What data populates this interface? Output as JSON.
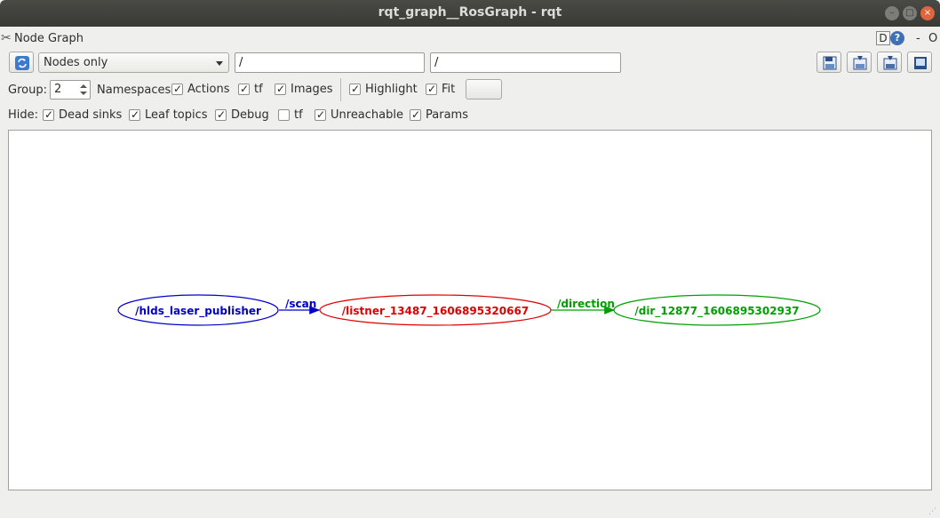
{
  "window": {
    "title": "rqt_graph__RosGraph - rqt"
  },
  "plugin": {
    "title": "Node Graph",
    "d_label": "D",
    "help_label": "?",
    "min_label": "-",
    "o_label": "O"
  },
  "toolbar": {
    "graph_type": "Nodes only",
    "filter_include": "/",
    "filter_exclude": "/"
  },
  "options": {
    "group_label": "Group:",
    "group_value": "2",
    "namespaces_label": "Namespaces",
    "actions_label": "Actions",
    "tf_label": "tf",
    "images_label": "Images",
    "highlight_label": "Highlight",
    "fit_label": "Fit"
  },
  "hide": {
    "label": "Hide:",
    "dead_sinks_label": "Dead sinks",
    "leaf_topics_label": "Leaf topics",
    "debug_label": "Debug",
    "tf_label": "tf",
    "unreachable_label": "Unreachable",
    "params_label": "Params"
  },
  "checkbox_states": {
    "actions": true,
    "tf": true,
    "images": true,
    "highlight": true,
    "fit": true,
    "dead_sinks": true,
    "leaf_topics": true,
    "debug": true,
    "hide_tf": false,
    "unreachable": true,
    "params": true
  },
  "graph": {
    "nodes": [
      {
        "label": "/hlds_laser_publisher",
        "color": "#0000cc"
      },
      {
        "label": "/listner_13487_1606895320667",
        "color": "#e00000"
      },
      {
        "label": "/dir_12877_1606895302937",
        "color": "#00a000"
      }
    ],
    "edges": [
      {
        "label": "/scan",
        "color": "#0000cc"
      },
      {
        "label": "/direction",
        "color": "#00a000"
      }
    ]
  }
}
